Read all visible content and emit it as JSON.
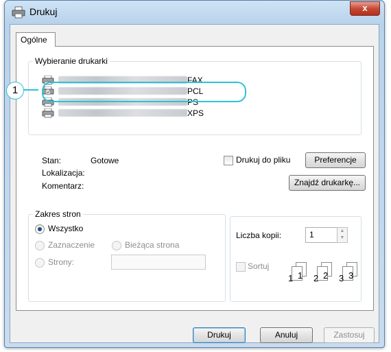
{
  "window": {
    "title": "Drukuj",
    "close_label": "x"
  },
  "tabs": [
    {
      "label": "Ogólne"
    }
  ],
  "printer_select": {
    "legend": "Wybieranie drukarki",
    "printers": [
      {
        "suffix": "FAX"
      },
      {
        "suffix": "PCL"
      },
      {
        "suffix": "PS"
      },
      {
        "suffix": "XPS"
      }
    ],
    "callout_number": "1"
  },
  "status": {
    "stan_label": "Stan:",
    "stan_value": "Gotowe",
    "location_label": "Lokalizacja:",
    "comment_label": "Komentarz:",
    "print_to_file_label": "Drukuj do pliku",
    "preferences_button": "Preferencje",
    "find_printer_button": "Znajdź drukarkę..."
  },
  "page_range": {
    "legend": "Zakres stron",
    "all": "Wszystko",
    "selection": "Zaznaczenie",
    "current_page": "Bieżąca strona",
    "pages": "Strony:",
    "pages_value": ""
  },
  "copies": {
    "count_label": "Liczba kopii:",
    "count_value": "1",
    "collate_label": "Sortuj",
    "collate_pages": [
      "1",
      "1",
      "2",
      "2",
      "3",
      "3"
    ]
  },
  "footer": {
    "print_button": "Drukuj",
    "cancel_button": "Anuluj",
    "apply_button": "Zastosuj"
  }
}
